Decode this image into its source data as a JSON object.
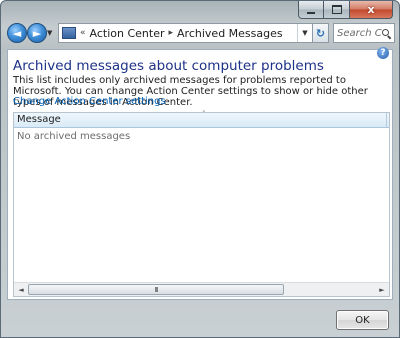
{
  "window": {
    "caption_buttons": {
      "close_glyph": "x"
    }
  },
  "nav": {
    "back_glyph": "◄",
    "forward_glyph": "►",
    "breadcrumb_prefix": "«",
    "breadcrumb": [
      "Action Center",
      "Archived Messages"
    ],
    "breadcrumb_separator": "▸",
    "refresh_glyph": "↻",
    "search_placeholder": "Search Con..."
  },
  "content": {
    "help_glyph": "?",
    "heading": "Archived messages about computer problems",
    "description": "This list includes only archived messages for problems reported to Microsoft. You can change Action Center settings to show or hide other types of messages in Action Center.",
    "settings_link": "Change Action Center settings",
    "table": {
      "column_header": "Message",
      "sort_indicator": "˄",
      "empty_text": "No archived messages"
    },
    "scrollbar": {
      "thumb_grip": "III"
    }
  },
  "footer": {
    "ok_label": "OK"
  },
  "colors": {
    "heading": "#1e3287",
    "link": "#0060b8",
    "close_button": "#c2472b"
  }
}
